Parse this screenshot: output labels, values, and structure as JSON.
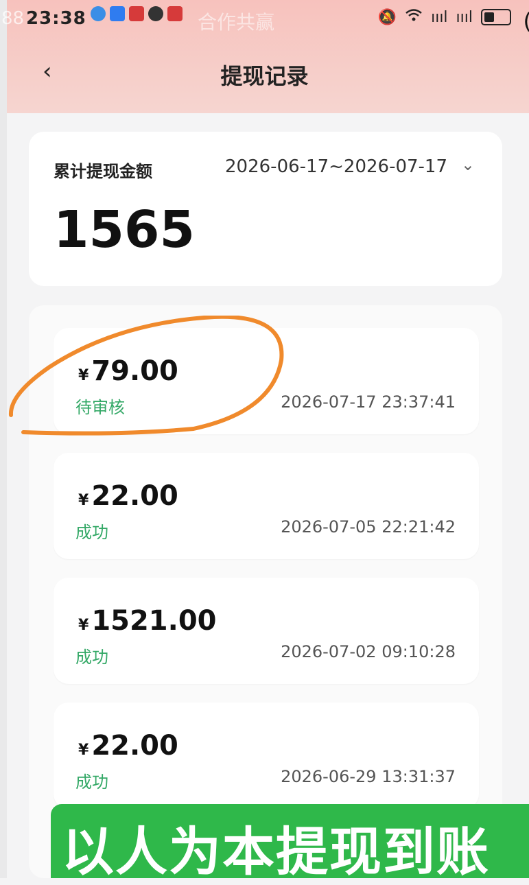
{
  "status_bar": {
    "time": "23:38",
    "faint_prefix": "88",
    "ghost_text": "合作共赢",
    "signal_1": "ıııl",
    "signal_2": "ıııl",
    "edge_char": "("
  },
  "navbar": {
    "back_glyph": "‹",
    "title": "提现记录"
  },
  "summary": {
    "label": "累计提现金额",
    "date_range": "2026-06-17~2026-07-17",
    "total": "1565"
  },
  "records": [
    {
      "currency": "¥",
      "amount": "79.00",
      "status": "待审核",
      "time": "2026-07-17 23:37:41"
    },
    {
      "currency": "¥",
      "amount": "22.00",
      "status": "成功",
      "time": "2026-07-05 22:21:42"
    },
    {
      "currency": "¥",
      "amount": "1521.00",
      "status": "成功",
      "time": "2026-07-02 09:10:28"
    },
    {
      "currency": "¥",
      "amount": "22.00",
      "status": "成功",
      "time": "2026-06-29 13:31:37"
    }
  ],
  "banner": {
    "text": "以人为本提现到账"
  },
  "colors": {
    "header": "#f7c2bd",
    "success_green": "#33a866",
    "banner_green": "#2fb84a",
    "annotation_orange": "#f08a2c"
  }
}
